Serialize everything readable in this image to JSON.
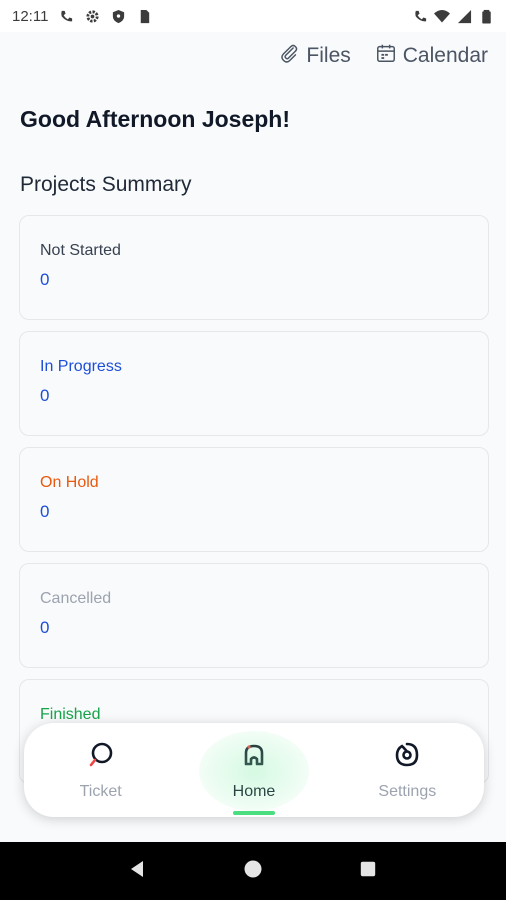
{
  "status_bar": {
    "time": "12:11",
    "left_icons": [
      "phone-icon",
      "gear-icon",
      "shield-icon",
      "sim-icon"
    ],
    "right_icons": [
      "phone-icon",
      "wifi-icon",
      "signal-icon",
      "battery-icon"
    ]
  },
  "top_actions": {
    "files_label": "Files",
    "calendar_label": "Calendar"
  },
  "greeting": "Good Afternoon Joseph!",
  "section_title": "Projects Summary",
  "cards": [
    {
      "label": "Not Started",
      "value": "0",
      "label_color": "#374151"
    },
    {
      "label": "In Progress",
      "value": "0",
      "label_color": "#1d4ed8"
    },
    {
      "label": "On Hold",
      "value": "0",
      "label_color": "#ea580c"
    },
    {
      "label": "Cancelled",
      "value": "0",
      "label_color": "#9ca3af"
    },
    {
      "label": "Finished",
      "value": "",
      "label_color": "#16a34a"
    }
  ],
  "bottom_nav": {
    "items": [
      {
        "label": "Ticket",
        "icon": "ticket-icon"
      },
      {
        "label": "Home",
        "icon": "home-icon",
        "active": true
      },
      {
        "label": "Settings",
        "icon": "settings-icon"
      }
    ],
    "active_color": "#4ade80"
  },
  "colors": {
    "value_blue": "#1d4ed8",
    "background": "#f8fafc"
  }
}
